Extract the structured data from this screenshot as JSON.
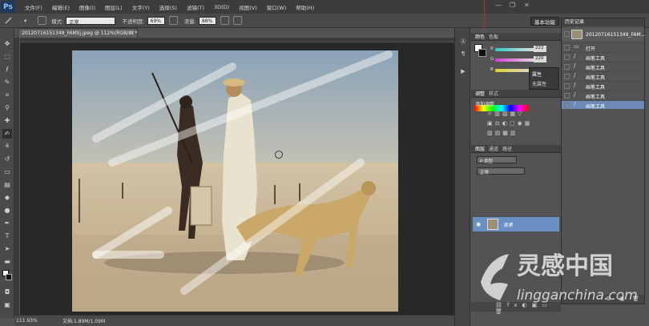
{
  "menubar": {
    "logo": "Ps",
    "items": [
      "文件(F)",
      "编辑(E)",
      "图像(I)",
      "图层(L)",
      "文字(Y)",
      "选择(S)",
      "滤镜(T)",
      "3D(D)",
      "视图(V)",
      "窗口(W)",
      "帮助(H)"
    ],
    "window_controls": [
      "—",
      "❐",
      "✕"
    ]
  },
  "options": {
    "mode_label": "模式:",
    "mode_value": "正常",
    "opacity_label": "不透明度:",
    "opacity_value": "69%",
    "flow_label": "流量:",
    "flow_value": "88%",
    "workspace": "基本功能"
  },
  "document": {
    "tab_title": "20120716151349_FAMSj.jpeg @ 112%(RGB/8) *",
    "zoom": "111.93%",
    "doc_info": "文档:1.89M/1.09M"
  },
  "color_panel": {
    "tabs": [
      "颜色",
      "色板"
    ],
    "r_label": "R",
    "r_value": "222",
    "g_label": "G",
    "g_value": "220",
    "b_label": "B"
  },
  "properties_popup": {
    "title": "属性",
    "text": "无属性"
  },
  "adjustments_panel": {
    "tabs": [
      "调整",
      "样式"
    ],
    "title": "添加调整"
  },
  "layers_panel": {
    "tabs": [
      "图层",
      "通道",
      "路径"
    ],
    "kind": "P 类型",
    "blend": "正常",
    "layer_name": "背景"
  },
  "history_panel": {
    "title": "历史记录",
    "snapshot": "20120716151349_FAM...",
    "items": [
      "打开",
      "画笔工具",
      "画笔工具",
      "画笔工具",
      "画笔工具",
      "画笔工具",
      "画笔工具"
    ],
    "selected_index": 6
  },
  "watermark": {
    "cn": "灵感中国",
    "en": "lingganchina.com"
  },
  "colors": {
    "accent": "#6d89b6",
    "panel_bg": "#535353",
    "guide": "#b03030"
  }
}
